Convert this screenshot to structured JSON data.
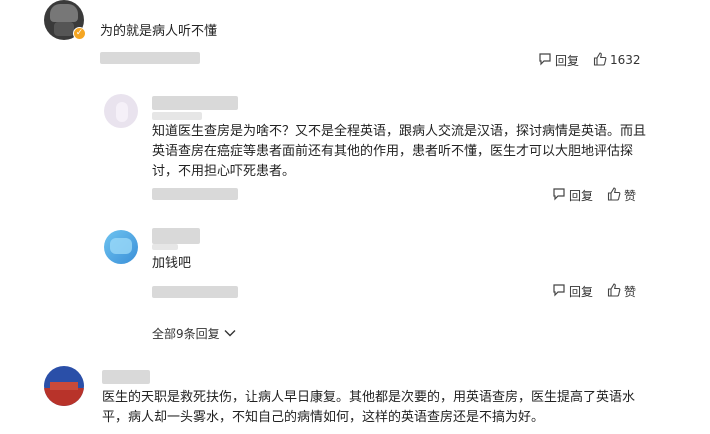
{
  "comments": [
    {
      "text": "为的就是病人听不懂",
      "reply_label": "回复",
      "like_count": "1632"
    },
    {
      "text_lines": [
        "知道医生查房是为啥不？又不是全程英语，跟病人交流是汉语，探讨病情是英语。而且",
        "英语查房在癌症等患者面前还有其他的作用，患者听不懂，医生才可以大胆地评估探",
        "讨，不用担心吓死患者。"
      ],
      "reply_label": "回复",
      "like_label": "赞"
    },
    {
      "text": "加钱吧",
      "reply_label": "回复",
      "like_label": "赞"
    },
    {
      "text_lines": [
        "医生的天职是救死扶伤，让病人早日康复。其他都是次要的，用英语查房，医生提高了英语水",
        "平，病人却一头雾水，不知自己的病情如何，这样的英语查房还是不搞为好。"
      ]
    }
  ],
  "show_all_replies": "全部9条回复",
  "icons": {
    "reply": "comment-bubble-icon",
    "like": "thumbs-up-icon",
    "expand": "chevron-down-icon",
    "verified": "verified-badge-icon"
  },
  "colors": {
    "verified_badge": "#f5a623",
    "text": "#222222",
    "placeholder_blur": "#d9d9d9"
  }
}
